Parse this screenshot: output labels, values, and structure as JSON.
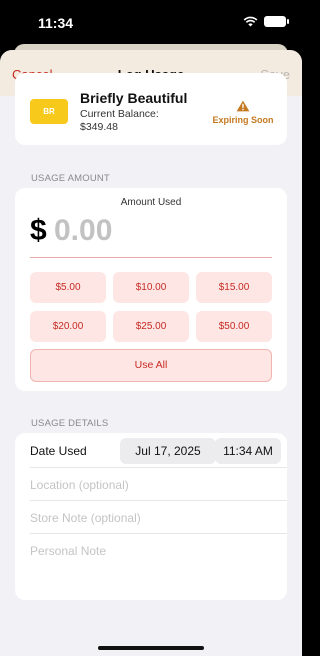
{
  "status": {
    "time": "11:34"
  },
  "nav": {
    "cancel": "Cancel",
    "title": "Log Usage",
    "save": "Save"
  },
  "card": {
    "logo_text": "BR",
    "name": "Briefly Beautiful",
    "balance_label": "Current Balance:",
    "balance_value": "$349.48",
    "badge": "Expiring Soon"
  },
  "usage_amount": {
    "section_label": "USAGE AMOUNT",
    "amount_label": "Amount Used",
    "currency": "$",
    "value_placeholder": "0.00",
    "quick_amounts": [
      "$5.00",
      "$10.00",
      "$15.00",
      "$20.00",
      "$25.00",
      "$50.00"
    ],
    "use_all": "Use All"
  },
  "usage_details": {
    "section_label": "USAGE DETAILS",
    "date_label": "Date Used",
    "date": "Jul 17, 2025",
    "time": "11:34 AM",
    "location_placeholder": "Location (optional)",
    "store_note_placeholder": "Store Note (optional)",
    "personal_note_placeholder": "Personal Note"
  },
  "colors": {
    "accent": "#c62b24",
    "chip_bg": "#fde6e4",
    "warning": "#c47a22",
    "nav_bg": "#f3ebe0",
    "logo_bg": "#f6c91a"
  }
}
